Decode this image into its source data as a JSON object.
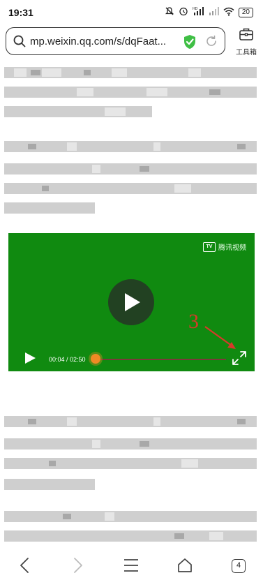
{
  "status_bar": {
    "time": "19:31",
    "network_label": "HD",
    "battery": "20"
  },
  "address_bar": {
    "url": "mp.weixin.qq.com/s/dqFaat..."
  },
  "toolbox": {
    "label": "工具箱"
  },
  "video": {
    "provider_badge": "TV",
    "provider_name": "腾讯视频",
    "current_time": "00:04",
    "duration": "02:50",
    "time_display": "00:04 / 02:50",
    "progress": 0.024,
    "background_color": "#108a10"
  },
  "annotation": {
    "label": "3",
    "color": "#d63a2a"
  },
  "bottom_nav": {
    "tab_count": "4"
  },
  "icons": {
    "search": "search-icon",
    "secure": "shield-check-icon",
    "reload": "reload-icon",
    "toolbox": "toolbox-icon",
    "back": "back-icon",
    "forward": "forward-icon",
    "menu": "menu-icon",
    "home": "home-icon",
    "tabs": "tabs-icon",
    "play": "play-icon",
    "fullscreen": "fullscreen-icon"
  }
}
